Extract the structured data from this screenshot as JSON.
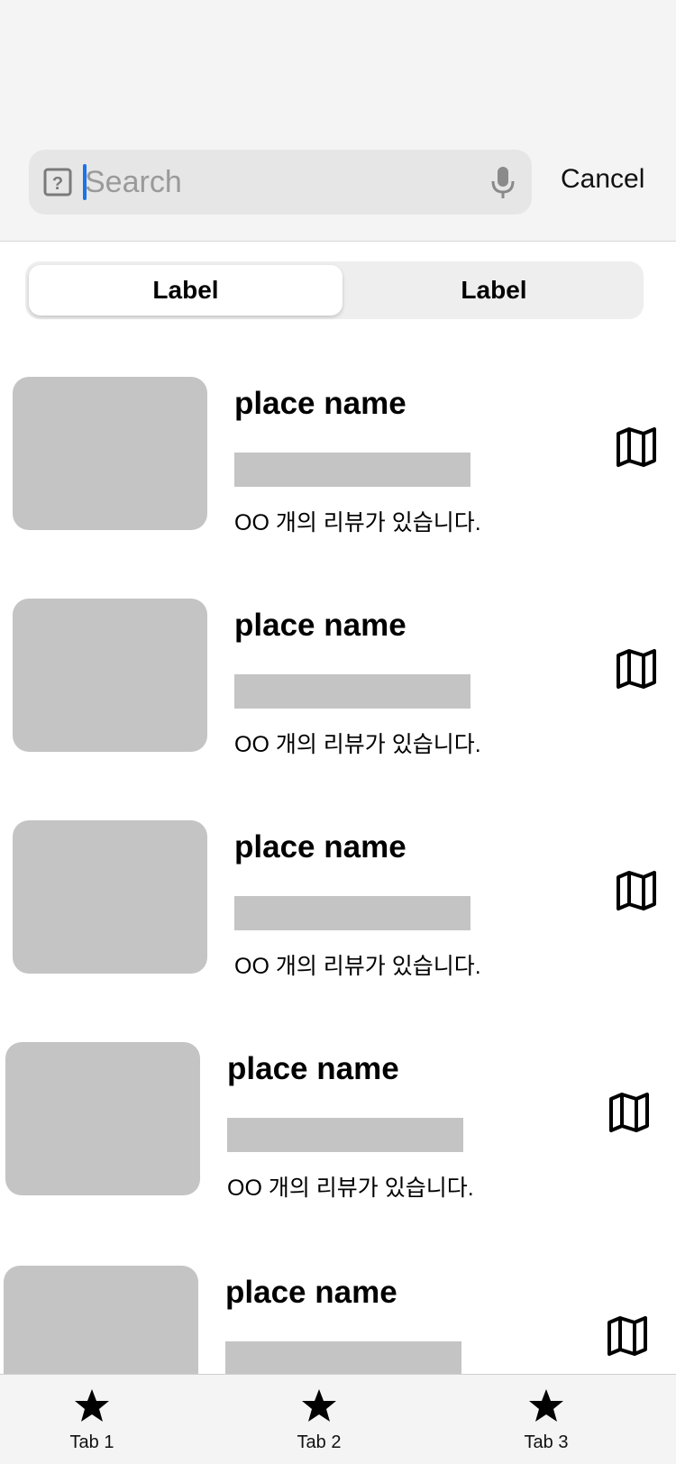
{
  "search": {
    "placeholder": "Search",
    "value": "",
    "left_icon": "question-box-icon",
    "right_icon": "mic-icon",
    "cancel_label": "Cancel"
  },
  "segmented_control": {
    "segments": [
      {
        "label": "Label",
        "selected": true
      },
      {
        "label": "Label",
        "selected": false
      }
    ]
  },
  "places": [
    {
      "name": "place name",
      "reviews": "OO 개의 리뷰가 있습니다.",
      "action_icon": "map-icon"
    },
    {
      "name": "place name",
      "reviews": "OO 개의 리뷰가 있습니다.",
      "action_icon": "map-icon"
    },
    {
      "name": "place name",
      "reviews": "OO 개의 리뷰가 있습니다.",
      "action_icon": "map-icon"
    },
    {
      "name": "place name",
      "reviews": "OO 개의 리뷰가 있습니다.",
      "action_icon": "map-icon"
    },
    {
      "name": "place name",
      "reviews": "",
      "action_icon": "map-icon"
    }
  ],
  "tab_bar": {
    "tabs": [
      {
        "label": "Tab 1",
        "icon": "star-icon"
      },
      {
        "label": "Tab 2",
        "icon": "star-icon"
      },
      {
        "label": "Tab 3",
        "icon": "star-icon"
      }
    ]
  },
  "colors": {
    "caret": "#1a73e8",
    "placeholder_gray": "#c4c4c4",
    "header_bg": "#f4f4f4",
    "search_bg": "#e6e6e6"
  }
}
